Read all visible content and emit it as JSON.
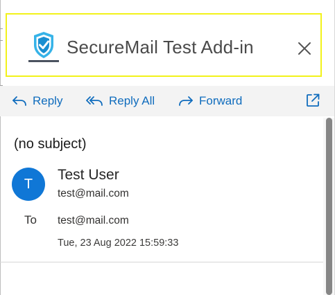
{
  "header": {
    "title": "SecureMail Test Add-in",
    "logo_icon": "shield-check-icon",
    "close_icon": "close-icon"
  },
  "toolbar": {
    "reply_label": "Reply",
    "reply_all_label": "Reply All",
    "forward_label": "Forward",
    "popout_icon": "popout-icon"
  },
  "message": {
    "subject": "(no subject)",
    "avatar_initial": "T",
    "sender_name": "Test User",
    "sender_email": "test@mail.com",
    "to_label": "To",
    "to_email": "test@mail.com",
    "date": "Tue, 23 Aug 2022 15:59:33"
  },
  "colors": {
    "accent": "#0f6cbd",
    "avatar": "#1077d6",
    "highlight": "#f2f21a"
  }
}
